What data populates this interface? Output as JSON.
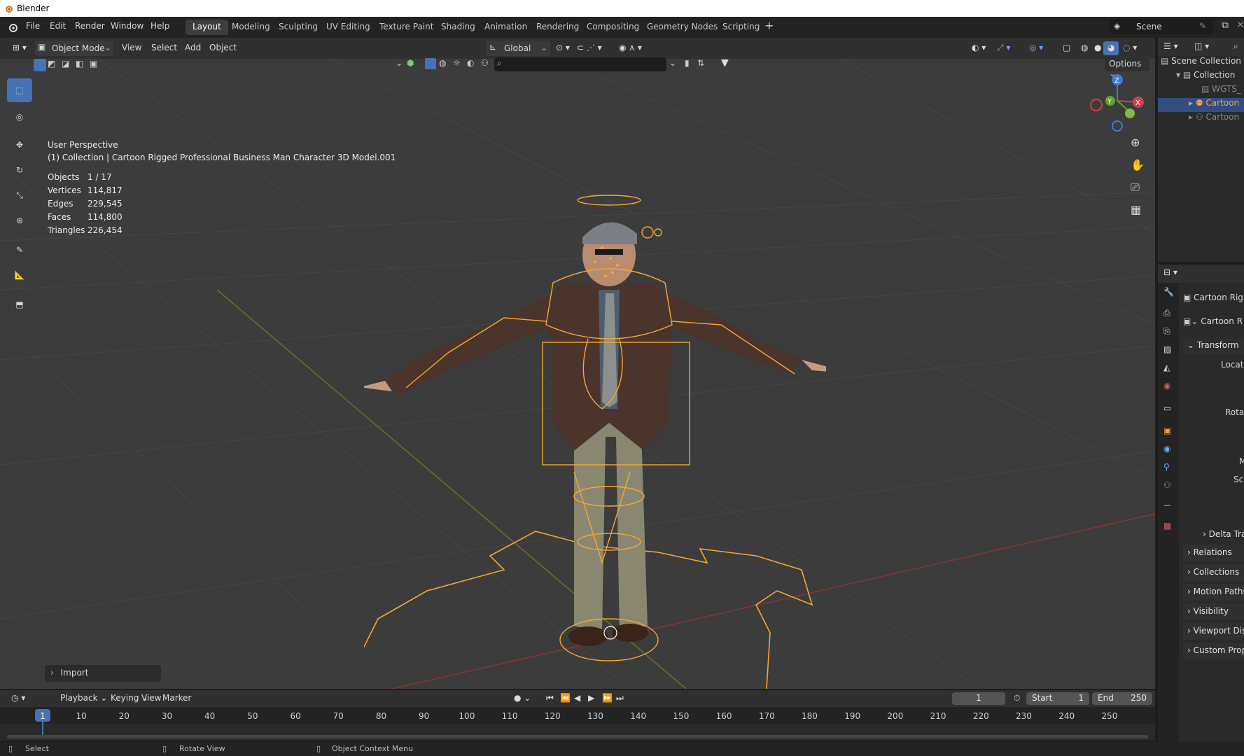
{
  "window": {
    "title": "Blender"
  },
  "menus": [
    "File",
    "Edit",
    "Render",
    "Window",
    "Help"
  ],
  "workspaces": [
    "Layout",
    "Modeling",
    "Sculpting",
    "UV Editing",
    "Texture Paint",
    "Shading",
    "Animation",
    "Rendering",
    "Compositing",
    "Geometry Nodes",
    "Scripting"
  ],
  "active_workspace": "Layout",
  "scene_name": "Scene",
  "viewport_header": {
    "mode": "Object Mode",
    "menus": [
      "View",
      "Select",
      "Add",
      "Object"
    ],
    "orientation": "Global",
    "options": "Options"
  },
  "viewport": {
    "perspective": "User Perspective",
    "collection_label": "(1) Collection | Cartoon Rigged Professional Business Man Character 3D Model.001",
    "stats": [
      {
        "k": "Objects",
        "v": "1 / 17"
      },
      {
        "k": "Vertices",
        "v": "114,817"
      },
      {
        "k": "Edges",
        "v": "229,545"
      },
      {
        "k": "Faces",
        "v": "114,800"
      },
      {
        "k": "Triangles",
        "v": "226,454"
      }
    ],
    "import_panel": "Import",
    "gizmo_axes": {
      "x": "X",
      "y": "Y",
      "z": "Z"
    }
  },
  "outliner": {
    "items": [
      "Scene Collection",
      "Collection",
      "WGTS_",
      "Cartoon",
      "Cartoon"
    ]
  },
  "properties": {
    "object_name": "Cartoon Rig",
    "data_name": "Cartoon R",
    "transform": "Transform",
    "fields": [
      "Locatio",
      "Rotatio",
      "M",
      "Sca"
    ],
    "panels": [
      "Delta Tra",
      "Relations",
      "Collections",
      "Motion Paths",
      "Visibility",
      "Viewport Dis",
      "Custom Prop"
    ]
  },
  "timeline": {
    "menus": [
      "Playback",
      "Keying",
      "View",
      "Marker"
    ],
    "current_frame": "1",
    "start_label": "Start",
    "start": "1",
    "end_label": "End",
    "end": "250",
    "ticks": [
      "1",
      "10",
      "20",
      "30",
      "40",
      "50",
      "60",
      "70",
      "80",
      "90",
      "100",
      "110",
      "120",
      "130",
      "140",
      "150",
      "160",
      "170",
      "180",
      "190",
      "200",
      "210",
      "220",
      "230",
      "240",
      "250"
    ]
  },
  "statusbar": {
    "items": [
      "Select",
      "Rotate View",
      "Object Context Menu"
    ]
  },
  "colors": {
    "accent": "#4772b3",
    "selection_orange": "#f5a733",
    "viewport_bg": "#3c3c3c"
  }
}
